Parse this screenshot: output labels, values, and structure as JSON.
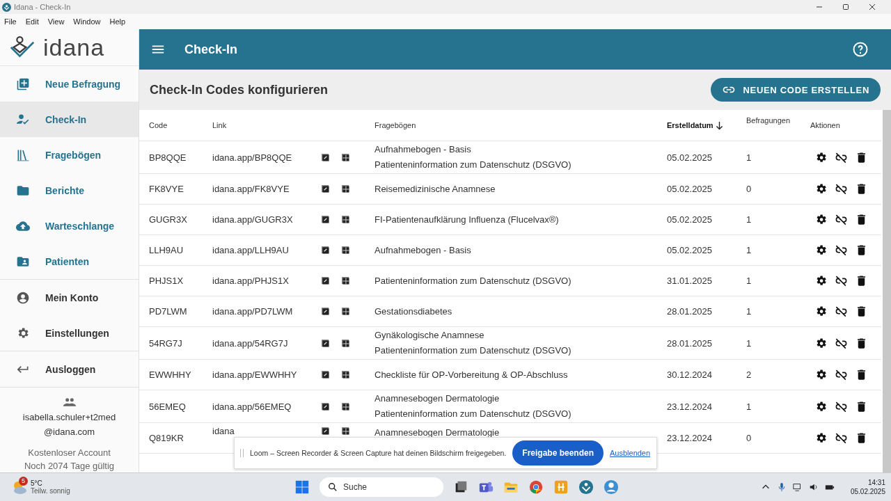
{
  "window": {
    "title": "Idana - Check-In"
  },
  "menu": [
    "File",
    "Edit",
    "View",
    "Window",
    "Help"
  ],
  "logo": "idana",
  "sidebar": {
    "groups": [
      [
        {
          "label": "Neue Befragung",
          "kind": "add",
          "selected": false
        },
        {
          "label": "Check-In",
          "kind": "checkin",
          "selected": true
        },
        {
          "label": "Fragebögen",
          "kind": "library",
          "selected": false
        },
        {
          "label": "Berichte",
          "kind": "folder",
          "selected": false
        },
        {
          "label": "Warteschlange",
          "kind": "cloud",
          "selected": false
        },
        {
          "label": "Patienten",
          "kind": "patients",
          "selected": false
        }
      ],
      [
        {
          "label": "Mein Konto",
          "kind": "account",
          "selected": false
        },
        {
          "label": "Einstellungen",
          "kind": "settings",
          "selected": false
        }
      ],
      [
        {
          "label": "Ausloggen",
          "kind": "logout",
          "selected": false
        }
      ]
    ]
  },
  "account": {
    "email_lines": [
      "isabella.schuler+t2med",
      "@idana.com"
    ],
    "plan": "Kostenloser Account",
    "validity": "Noch 2074 Tage gültig"
  },
  "header": {
    "title": "Check-In"
  },
  "page": {
    "title": "Check-In Codes konfigurieren",
    "button": "NEUEN CODE ERSTELLEN"
  },
  "table": {
    "columns": [
      {
        "label": "Code",
        "sorted": false
      },
      {
        "label": "Link",
        "sorted": false
      },
      {
        "label": "Fragebögen",
        "sorted": false
      },
      {
        "label": "Erstelldatum",
        "sorted": true
      },
      {
        "label": "Befragungen",
        "sorted": false
      },
      {
        "label": "Aktionen",
        "sorted": false
      }
    ],
    "rows": [
      {
        "code": "BP8QQE",
        "link": "idana.app/BP8QQE",
        "questionnaires": [
          "Aufnahmebogen - Basis",
          "Patienteninformation zum Datenschutz (DSGVO)"
        ],
        "date": "05.02.2025",
        "count": "1"
      },
      {
        "code": "FK8VYE",
        "link": "idana.app/FK8VYE",
        "questionnaires": [
          "Reisemedizinische Anamnese"
        ],
        "date": "05.02.2025",
        "count": "0"
      },
      {
        "code": "GUGR3X",
        "link": "idana.app/GUGR3X",
        "questionnaires": [
          "FI-Patientenaufklärung Influenza (Flucelvax®)"
        ],
        "date": "05.02.2025",
        "count": "1"
      },
      {
        "code": "LLH9AU",
        "link": "idana.app/LLH9AU",
        "questionnaires": [
          "Aufnahmebogen - Basis"
        ],
        "date": "05.02.2025",
        "count": "1"
      },
      {
        "code": "PHJS1X",
        "link": "idana.app/PHJS1X",
        "questionnaires": [
          "Patienteninformation zum Datenschutz (DSGVO)"
        ],
        "date": "31.01.2025",
        "count": "1"
      },
      {
        "code": "PD7LWM",
        "link": "idana.app/PD7LWM",
        "questionnaires": [
          "Gestationsdiabetes"
        ],
        "date": "28.01.2025",
        "count": "1"
      },
      {
        "code": "54RG7J",
        "link": "idana.app/54RG7J",
        "questionnaires": [
          "Gynäkologische Anamnese",
          "Patienteninformation zum Datenschutz (DSGVO)"
        ],
        "date": "28.01.2025",
        "count": "1"
      },
      {
        "code": "EWWHHY",
        "link": "idana.app/EWWHHY",
        "questionnaires": [
          "Checkliste für OP-Vorbereitung & OP-Abschluss"
        ],
        "date": "30.12.2024",
        "count": "2"
      },
      {
        "code": "56EMEQ",
        "link": "idana.app/56EMEQ",
        "questionnaires": [
          "Anamnesebogen Dermatologie",
          "Patienteninformation zum Datenschutz (DSGVO)"
        ],
        "date": "23.12.2024",
        "count": "1"
      },
      {
        "code": "Q819KR",
        "link": "idana",
        "questionnaires": [
          "Anamnesebogen Dermatologie"
        ],
        "date": "23.12.2024",
        "count": "0"
      }
    ]
  },
  "loom_bar": {
    "message": "Loom – Screen Recorder & Screen Capture hat deinen Bildschirm freigegeben.",
    "primary": "Freigabe beenden",
    "secondary": "Ausblenden"
  },
  "taskbar": {
    "weather": {
      "badge": "5",
      "temp": "5°C",
      "desc": "Teilw. sonnig"
    },
    "search": {
      "placeholder": "Suche"
    },
    "time": "14:31",
    "date": "05.02.2025"
  }
}
